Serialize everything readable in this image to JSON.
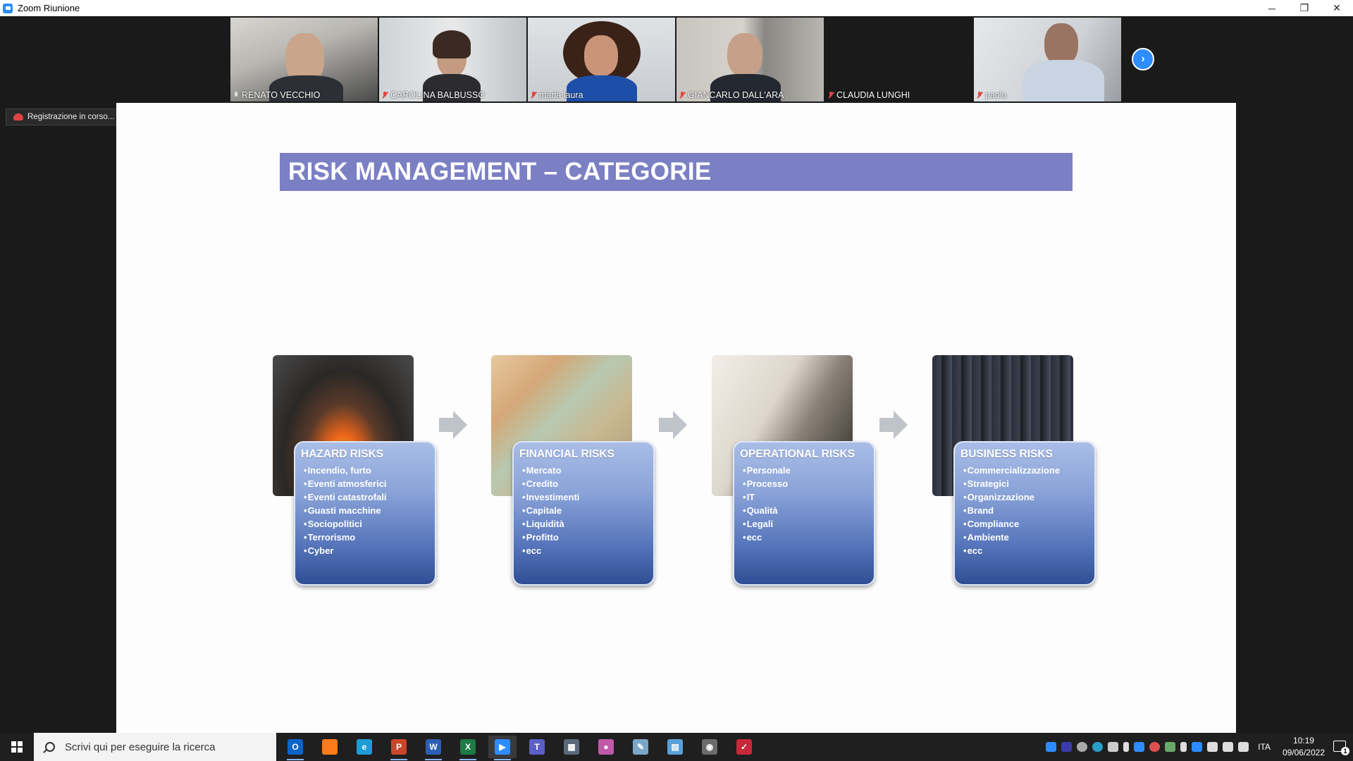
{
  "window": {
    "title": "Zoom Riunione",
    "controls": {
      "minimize": "─",
      "restore": "❐",
      "close": "✕"
    }
  },
  "participants": [
    {
      "name": "RENATO VECCHIO",
      "muted": false,
      "active": true
    },
    {
      "name": "CAROLINA BALBUSSO",
      "muted": true,
      "active": false
    },
    {
      "name": "maria laura",
      "muted": true,
      "active": false
    },
    {
      "name": "GIANCARLO DALL'ARA",
      "muted": true,
      "active": false
    },
    {
      "name": "CLAUDIA LUNGHI",
      "muted": true,
      "active": false
    },
    {
      "name": "paolo",
      "muted": true,
      "active": false
    }
  ],
  "next_button": "›",
  "recording": {
    "label": "Registrazione in corso..."
  },
  "slide": {
    "title": "RISK MANAGEMENT – CATEGORIE",
    "categories": [
      {
        "title": "HAZARD RISKS",
        "items": [
          "Incendio, furto",
          "Eventi  atmosferici",
          "Eventi catastrofali",
          "Guasti macchine",
          "Sociopolitici",
          "Terrorismo",
          "Cyber"
        ]
      },
      {
        "title": "FINANCIAL RISKS",
        "items": [
          "Mercato",
          "Credito",
          "Investimenti",
          "Capitale",
          "Liquidità",
          "Profitto",
          "ecc"
        ]
      },
      {
        "title": "OPERATIONAL RISKS",
        "items": [
          "Personale",
          "Processo",
          "IT",
          "Qualità",
          "Legali",
          "ecc"
        ]
      },
      {
        "title": "BUSINESS RISKS",
        "items": [
          "Commercializzazione",
          "Strategici",
          "Organizzazione",
          "Brand",
          "Compliance",
          "Ambiente",
          "ecc"
        ]
      }
    ]
  },
  "taskbar": {
    "search_placeholder": "Scrivi qui per eseguire la ricerca",
    "apps": [
      {
        "name": "outlook",
        "glyph": "O",
        "color": "#0a64c8"
      },
      {
        "name": "firefox",
        "glyph": "",
        "color": "#ff7a1a"
      },
      {
        "name": "edge",
        "glyph": "e",
        "color": "#1f9bd6"
      },
      {
        "name": "powerpoint",
        "glyph": "P",
        "color": "#c8472a"
      },
      {
        "name": "word",
        "glyph": "W",
        "color": "#2b5fb4"
      },
      {
        "name": "excel",
        "glyph": "X",
        "color": "#1d7a45"
      },
      {
        "name": "zoom",
        "glyph": "▶",
        "color": "#2d8cff"
      },
      {
        "name": "teams",
        "glyph": "T",
        "color": "#5b5fc7"
      },
      {
        "name": "calculator",
        "glyph": "▦",
        "color": "#5a6a7a"
      },
      {
        "name": "media",
        "glyph": "●",
        "color": "#c05aa8"
      },
      {
        "name": "paint",
        "glyph": "✎",
        "color": "#7aa6c8"
      },
      {
        "name": "notes",
        "glyph": "▤",
        "color": "#5aa0d8"
      },
      {
        "name": "camera",
        "glyph": "◉",
        "color": "#6b6b6b"
      },
      {
        "name": "pdf",
        "glyph": "✓",
        "color": "#c8283a"
      }
    ],
    "language": "ITA",
    "time": "10:19",
    "date": "09/06/2022",
    "notifications": "1"
  }
}
